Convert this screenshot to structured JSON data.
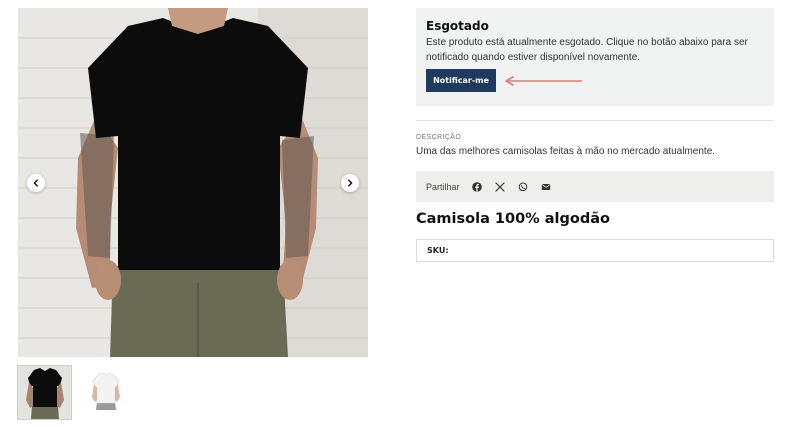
{
  "gallery": {
    "prev_icon": "chevron-left-icon",
    "next_icon": "chevron-right-icon",
    "main_image": "black-tshirt-model-photo",
    "thumbnails": [
      {
        "image": "black-tshirt-model-photo",
        "active": true
      },
      {
        "image": "white-tshirt-photo",
        "active": false
      }
    ]
  },
  "stock": {
    "title": "Esgotado",
    "message": "Este produto está atualmente esgotado. Clique no botão abaixo para ser notificado quando estiver disponível novamente.",
    "notify_label": "Notificar-me",
    "annotation_arrow_color": "#e07a7a"
  },
  "description": {
    "label": "DESCRIÇÃO",
    "text": "Uma das melhores camisolas feitas à mão no mercado atualmente."
  },
  "share": {
    "label": "Partilhar",
    "icons": [
      "facebook-icon",
      "x-icon",
      "whatsapp-icon",
      "mail-icon"
    ]
  },
  "product": {
    "title": "Camisola 100% algodão",
    "sku_label": "SKU:"
  },
  "colors": {
    "button_bg": "#1f3a5f",
    "panel_bg": "#f1f2f2"
  }
}
